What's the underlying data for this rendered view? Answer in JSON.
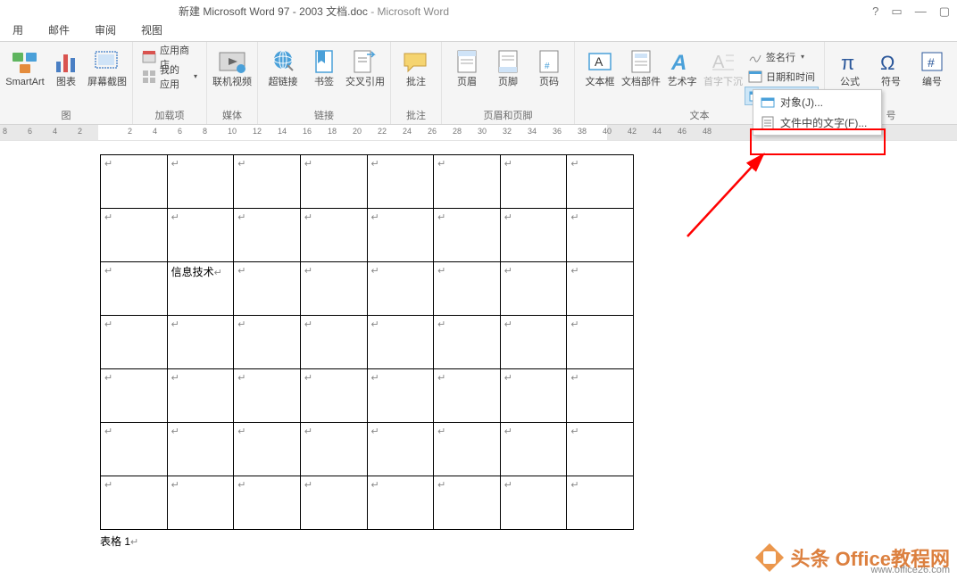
{
  "title": {
    "doc": "新建 Microsoft Word 97 - 2003 文档.doc",
    "sep": " - ",
    "app": "Microsoft Word"
  },
  "win": {
    "help": "?",
    "ribbon": "▭",
    "min": "—",
    "max": "▢"
  },
  "menu": {
    "t0": "用",
    "t1": "邮件",
    "t2": "审阅",
    "t3": "视图"
  },
  "ribbon": {
    "smartart": "SmartArt",
    "chart": "图表",
    "screenshot": "屏幕截图",
    "appstore": "应用商店",
    "myapps": "我的应用",
    "add_group": "加载项",
    "onlinevideo": "联机视频",
    "media_group": "媒体",
    "hyperlink": "超链接",
    "bookmark": "书签",
    "crossref": "交叉引用",
    "links_group": "链接",
    "comment": "批注",
    "comment_group": "批注",
    "header": "页眉",
    "footer": "页脚",
    "pagenum": "页码",
    "headerfooter_group": "页眉和页脚",
    "textbox": "文本框",
    "quickparts": "文档部件",
    "wordart": "艺术字",
    "dropcap": "首字下沉",
    "signature": "签名行",
    "datetime": "日期和时间",
    "object": "对象",
    "text_group": "文本",
    "equation": "公式",
    "symbol": "符号",
    "number": "编号",
    "symbol_group": "号",
    "illust_group": "图"
  },
  "dropdown": {
    "obj": "对象(J)...",
    "textfromfile": "文件中的文字(F)..."
  },
  "ruler": {
    "vals": [
      "8",
      "6",
      "4",
      "2",
      "2",
      "4",
      "6",
      "8",
      "10",
      "12",
      "14",
      "16",
      "18",
      "20",
      "22",
      "24",
      "26",
      "28",
      "30",
      "32",
      "34",
      "36",
      "38",
      "40",
      "42",
      "44",
      "46",
      "48"
    ]
  },
  "table": {
    "cell_text": "信息技术",
    "caption": "表格 1"
  },
  "wm": {
    "brand": "头条  Office教程网",
    "url": "www.office26.com"
  }
}
